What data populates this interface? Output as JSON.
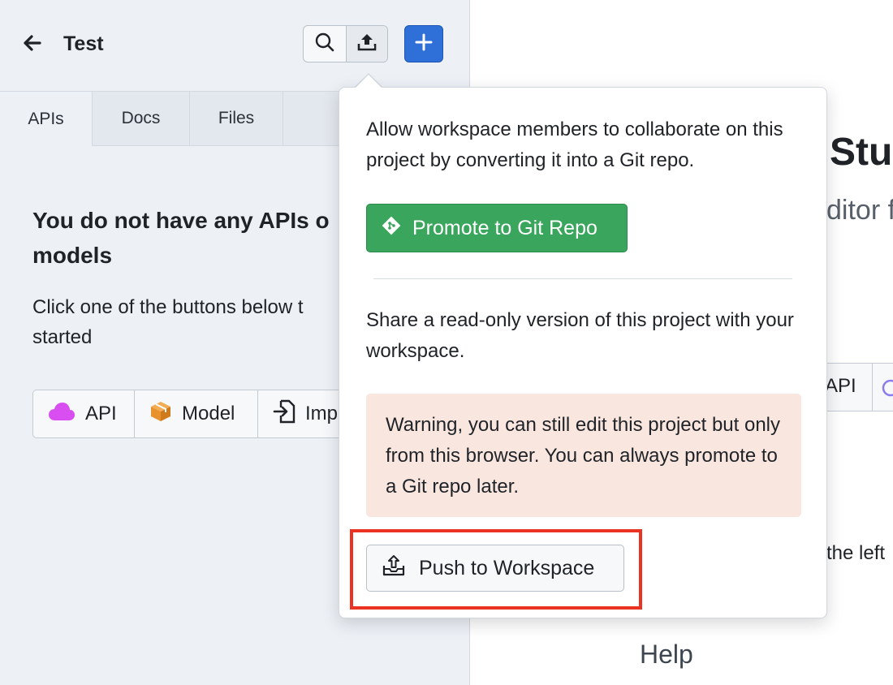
{
  "sidebar": {
    "back_icon": "arrow-left-icon",
    "title": "Test",
    "toolbar": {
      "search_icon": "search-icon",
      "upload_icon": "upload-icon",
      "add_icon": "plus-icon"
    },
    "tabs": [
      {
        "label": "APIs",
        "active": true
      },
      {
        "label": "Docs",
        "active": false
      },
      {
        "label": "Files",
        "active": false
      }
    ],
    "empty_state": {
      "heading_line1": "You do not have any APIs o",
      "heading_line2": "models",
      "text_line1": "Click one of the buttons below t",
      "text_line2": "started"
    },
    "create_buttons": [
      {
        "label": "API",
        "icon": "cloud-icon",
        "color": "#d94ef0"
      },
      {
        "label": "Model",
        "icon": "cube-icon",
        "color": "#e8922e"
      },
      {
        "label": "Imp",
        "icon": "import-icon",
        "color": "#1f2328"
      }
    ]
  },
  "main": {
    "title_fragment": "Stu",
    "subtitle_fragment": "ditor f",
    "api_button_fragment": "API",
    "hint_fragment": "the left",
    "help_label": "Help"
  },
  "popover": {
    "git_text": "Allow workspace members to collaborate on this project by converting it into a Git repo.",
    "promote_button": "Promote to Git Repo",
    "share_text": "Share a read-only version of this project with your workspace.",
    "warning_text": "Warning, you can still edit this project but only from this browser. You can always promote to a Git repo later.",
    "push_button": "Push to Workspace"
  },
  "colors": {
    "primary": "#2e6fd8",
    "success": "#3aa55c",
    "warning_bg": "#f9e6df",
    "highlight": "#ea3323"
  }
}
